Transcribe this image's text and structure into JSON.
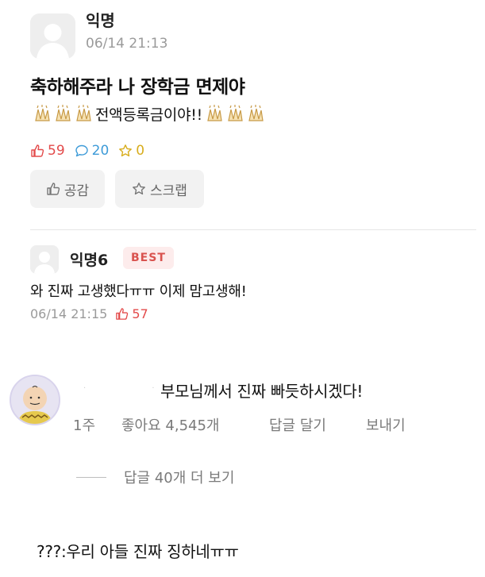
{
  "post": {
    "author": "익명",
    "time": "06/14 21:13",
    "title": "축하해주라 나 장학금 면제야",
    "body": "전액등록금이야!!",
    "stats": {
      "likes": "59",
      "comments": "20",
      "scraps": "0"
    },
    "buttons": {
      "like_label": "공감",
      "scrap_label": "스크랩"
    }
  },
  "comment": {
    "author": "익명6",
    "badge": "BEST",
    "text": "와 진짜 고생했다ㅠㅠ 이제 맘고생해!",
    "time": "06/14 21:15",
    "likes": "57"
  },
  "instagram_comment": {
    "text": "부모님께서 진짜 빠듯하시겠다!",
    "age": "1주",
    "likes": "좋아요 4,545개",
    "reply_label": "답글 달기",
    "send_label": "보내기",
    "view_replies": "답글 40개 더 보기"
  },
  "bottom_caption": "???:우리 아들 진짜 징하네ㅠㅠ",
  "colors": {
    "like_red": "#e34b4b",
    "comment_blue": "#3e9bd8",
    "scrap_yellow": "#d8ad1d",
    "best_badge_bg": "#fdecec"
  },
  "icons": [
    "default-avatar-icon",
    "clap-emoji-icon",
    "thumbs-up-icon",
    "speech-bubble-icon",
    "star-icon",
    "cartoon-avatar-icon"
  ]
}
